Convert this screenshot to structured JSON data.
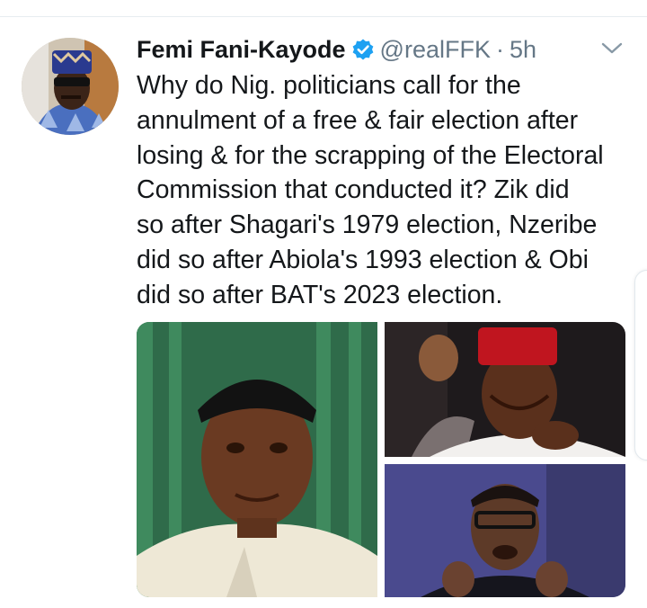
{
  "tweet": {
    "author_name": "Femi Fani-Kayode",
    "handle": "@realFFK",
    "separator": "·",
    "time": "5h",
    "verified": true,
    "text_lines": [
      "Why do Nig. politicians call for the",
      "annulment of a free & fair election after",
      "losing & for the scrapping of the Electoral",
      "Commission that conducted it? Zik did",
      "so after Shagari's 1979 election, Nzeribe",
      "did so after Abiola's 1993 election & Obi",
      "did so after BAT's 2023 election."
    ]
  },
  "icons": {
    "verified": "verified-badge-icon",
    "more": "chevron-down-icon"
  },
  "colors": {
    "verified_blue": "#1da1f2",
    "secondary_text": "#657786",
    "primary_text": "#14171a",
    "divider": "#e6ecf0"
  }
}
